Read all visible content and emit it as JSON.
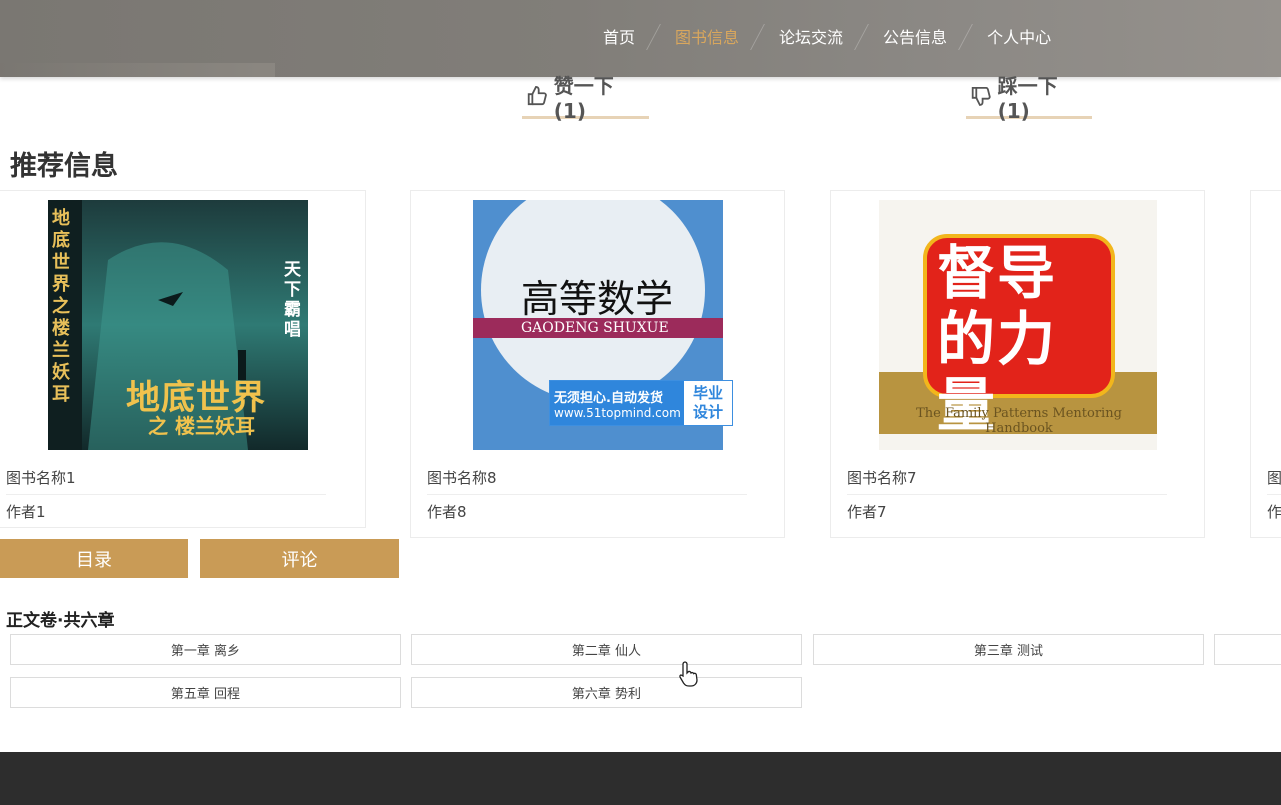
{
  "nav": {
    "items": [
      {
        "label": "首页",
        "active": false
      },
      {
        "label": "图书信息",
        "active": true
      },
      {
        "label": "论坛交流",
        "active": false
      },
      {
        "label": "公告信息",
        "active": false
      },
      {
        "label": "个人中心",
        "active": false
      }
    ]
  },
  "vote": {
    "up_label": "赞一下(1)",
    "down_label": "踩一下(1)"
  },
  "recommend": {
    "title": "推荐信息",
    "books": [
      {
        "name": "图书名称1",
        "author": "作者1",
        "cover_title": "地底世界",
        "cover_subtitle": "之 楼兰妖耳",
        "cover_author": "天下霸唱",
        "cover_side": "地底世界之楼兰妖耳"
      },
      {
        "name": "图书名称8",
        "author": "作者8",
        "cover_title": "高等数学",
        "cover_subtitle": "GAODENG SHUXUE"
      },
      {
        "name": "图书名称7",
        "author": "作者7",
        "cover_title": "督导的力量",
        "cover_subtitle": "The Family Patterns Mentoring Handbook"
      },
      {
        "name": "图",
        "author": "作"
      }
    ]
  },
  "tabs": {
    "catalog": "目录",
    "comment": "评论"
  },
  "chapters": {
    "volume_title": "正文卷·共六章",
    "items": [
      "第一章 离乡",
      "第二章 仙人",
      "第三章 测试",
      "第五章 回程",
      "第六章 势利"
    ]
  },
  "watermark": {
    "line1": "无须担心.自动发货",
    "line2": "www.51topmind.com",
    "right1": "毕业",
    "right2": "设计"
  },
  "colors": {
    "accent": "#c99b56",
    "nav_active": "#d9a75d",
    "footer": "#2d2d2d"
  }
}
